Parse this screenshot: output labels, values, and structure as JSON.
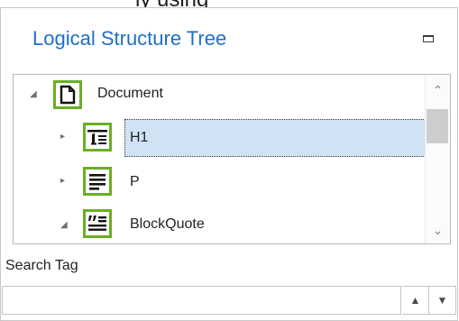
{
  "header_partial": "ly using",
  "panel": {
    "title": "Logical Structure Tree",
    "minimize_icon": "minimize-icon"
  },
  "tree": {
    "nodes": [
      {
        "label": "Document",
        "expander": "◢",
        "icon": "document-icon",
        "expanded": true,
        "selected": false
      },
      {
        "label": "H1",
        "expander": "▸",
        "icon": "heading1-icon",
        "expanded": false,
        "selected": true
      },
      {
        "label": "P",
        "expander": "▸",
        "icon": "paragraph-icon",
        "expanded": false,
        "selected": false
      },
      {
        "label": "BlockQuote",
        "expander": "◢",
        "icon": "blockquote-icon",
        "expanded": true,
        "selected": false
      }
    ],
    "scroll_up": "⌃",
    "scroll_down": "⌄"
  },
  "search": {
    "label": "Search Tag",
    "value": "",
    "placeholder": "",
    "spin_up": "▲",
    "spin_down": "▼"
  },
  "colors": {
    "title": "#1e6fc8",
    "icon_border": "#6cae24",
    "selection": "#cfe3f5"
  }
}
